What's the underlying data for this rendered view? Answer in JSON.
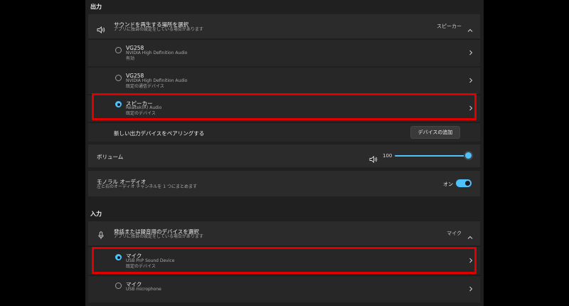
{
  "output": {
    "section_title": "出力",
    "header": {
      "title": "サウンドを再生する場所を選択",
      "subtitle": "アプリに独自の設定をしている場合があります",
      "selected": "スピーカー"
    },
    "devices": [
      {
        "name": "VG258",
        "driver": "NVIDIA High Definition Audio",
        "status": "有効",
        "selected": false
      },
      {
        "name": "VG258",
        "driver": "NVIDIA High Definition Audio",
        "status": "既定の通信デバイス",
        "selected": false
      },
      {
        "name": "スピーカー",
        "driver": "Realtek(R) Audio",
        "status": "既定のデバイス",
        "selected": true
      }
    ],
    "pair_label": "新しい出力デバイスをペアリングする",
    "add_device_button": "デバイスの追加",
    "volume": {
      "label": "ボリューム",
      "value": "100",
      "level": 1.0
    },
    "mono": {
      "title": "モノラル オーディオ",
      "subtitle": "左と右のオーディオ チャンネルを 1 つにまとめます",
      "state_label": "オン",
      "on": true
    }
  },
  "input": {
    "section_title": "入力",
    "header": {
      "title": "発話または録音用のデバイスを選択",
      "subtitle": "アプリに独自の設定をしている場合があります",
      "selected": "マイク"
    },
    "devices": [
      {
        "name": "マイク",
        "driver": "USB PnP Sound Device",
        "status": "既定のデバイス",
        "selected": true
      },
      {
        "name": "マイク",
        "driver": "USB microphone",
        "status": "",
        "selected": false
      }
    ]
  },
  "icons": {
    "speaker": "speaker-icon",
    "mic": "microphone-icon",
    "chevron_right": "chevron-right-icon",
    "chevron_up": "chevron-up-icon"
  },
  "colors": {
    "accent": "#4cc2ff",
    "highlight": "#e00000",
    "background": "#202020",
    "card": "#2b2b2b"
  }
}
